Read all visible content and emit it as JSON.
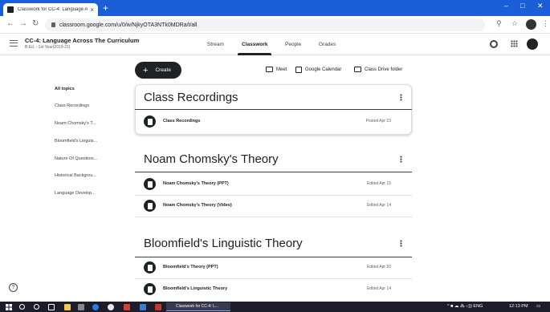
{
  "browser": {
    "tab_title": "Classwork for CC-4: Language Ac",
    "tab_close": "×",
    "new_tab": "+",
    "url": "classroom.google.com/u/0/w/NjkyOTA3NTk0MDRa/t/all",
    "window_controls": [
      "–",
      "□",
      "✕"
    ]
  },
  "header": {
    "course_title": "CC-4: Language Across The Curriculum",
    "course_subtitle": "B.Ed. - 1st Year(2019-21)",
    "tabs": [
      "Stream",
      "Classwork",
      "People",
      "Grades"
    ],
    "active_tab": "Classwork"
  },
  "actions": {
    "create_label": "Create",
    "create_plus": "+",
    "meet": "Meet",
    "calendar": "Google Calendar",
    "drive": "Class Drive folder"
  },
  "sidebar": {
    "items": [
      "All topics",
      "Class Recordings",
      "Noam Chomsky's T...",
      "Bloomfield's Linguis...",
      "Nature Of Questioni...",
      "Historical Backgrou...",
      "Language Develop..."
    ]
  },
  "topics": [
    {
      "title": "Class Recordings",
      "items": [
        {
          "title": "Class Recordings",
          "date": "Posted Apr 23"
        }
      ]
    },
    {
      "title": "Noam Chomsky's Theory",
      "items": [
        {
          "title": "Noam Chomsky's Theory (PPT)",
          "date": "Edited Apr 15"
        },
        {
          "title": "Noam Chomsky's Theory (Video)",
          "date": "Edited Apr 14"
        }
      ]
    },
    {
      "title": "Bloomfield's Linguistic Theory",
      "items": [
        {
          "title": "Bloomfield's Theory (PPT)",
          "date": "Edited Apr 20"
        },
        {
          "title": "Bloomfield's Linguistic Theory",
          "date": "Edited Apr 14"
        }
      ]
    }
  ],
  "help": "?",
  "taskbar": {
    "app_label": "Classwork for CC-4: L...",
    "tray_text": "^  ■  ☁  ⁂  ◁))  ENG",
    "time": "12:13 PM"
  }
}
